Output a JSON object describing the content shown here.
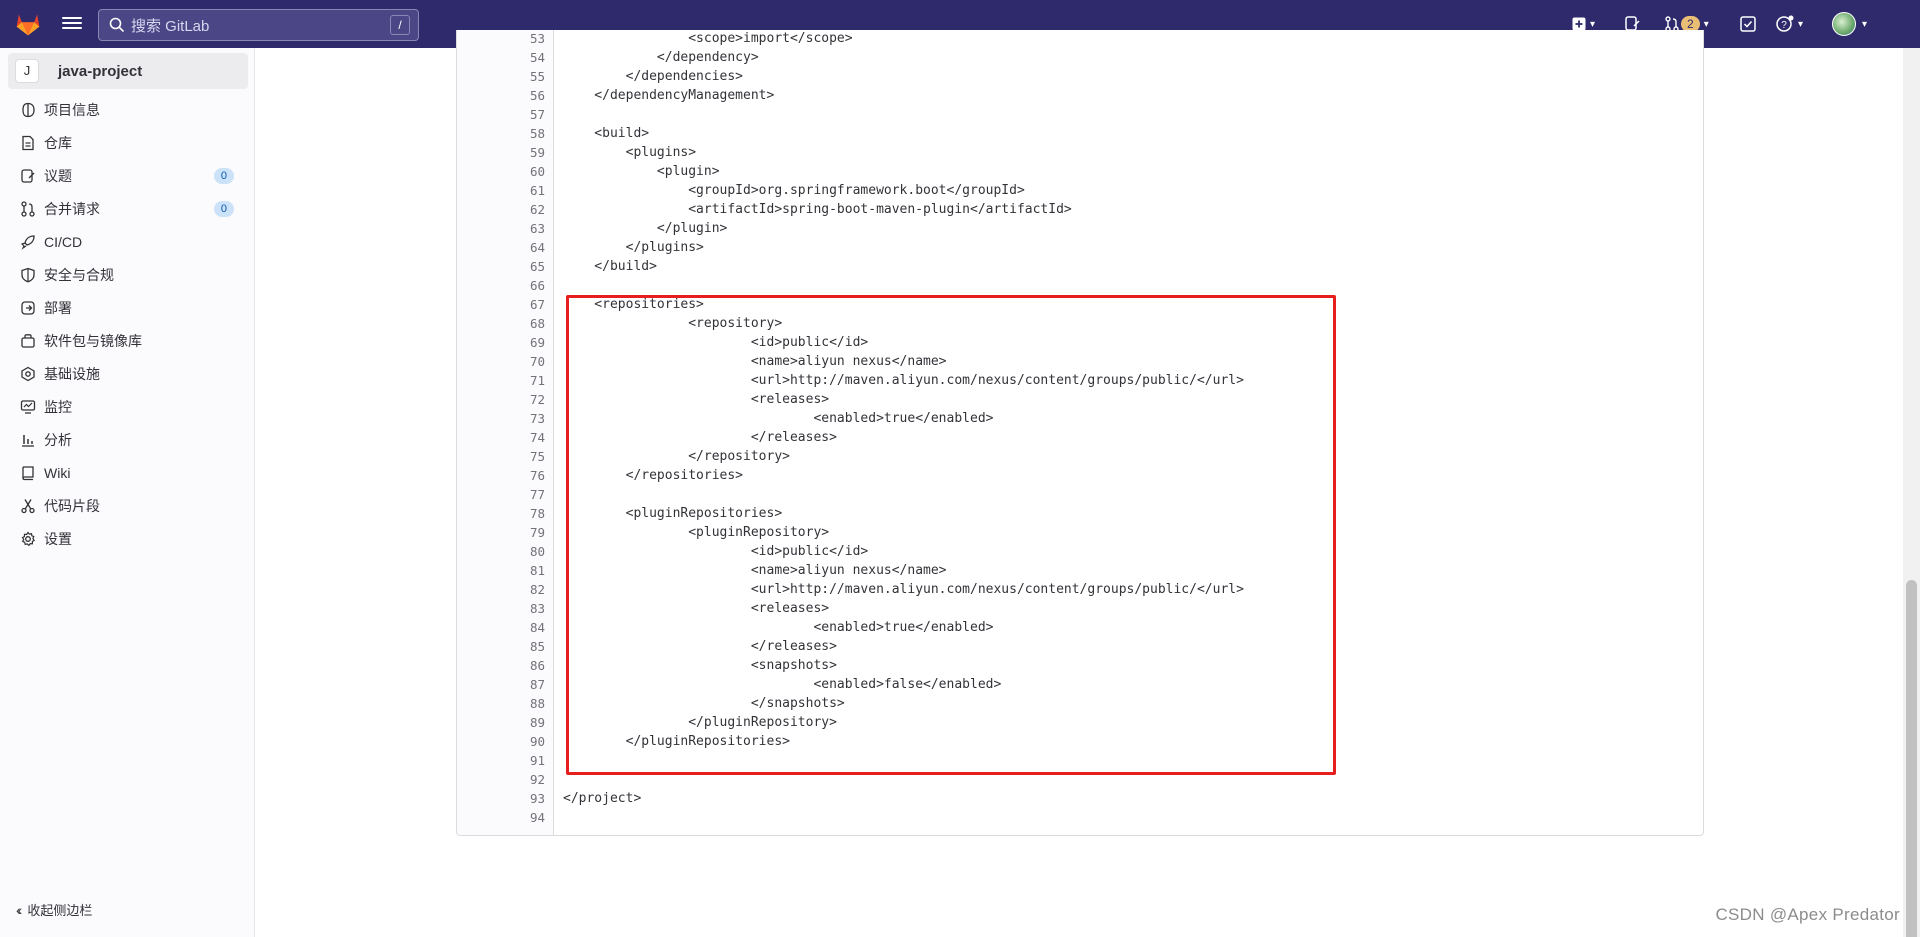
{
  "topbar": {
    "search_placeholder": "搜索 GitLab",
    "search_shortcut": "/",
    "merge_requests_count": "2"
  },
  "sidebar": {
    "project_avatar_letter": "J",
    "project_name": "java-project",
    "items": [
      {
        "label": "项目信息",
        "icon": "info-icon"
      },
      {
        "label": "仓库",
        "icon": "document-icon"
      },
      {
        "label": "议题",
        "icon": "issues-icon",
        "count": "0"
      },
      {
        "label": "合并请求",
        "icon": "merge-request-icon",
        "count": "0"
      },
      {
        "label": "CI/CD",
        "icon": "rocket-icon"
      },
      {
        "label": "安全与合规",
        "icon": "shield-icon"
      },
      {
        "label": "部署",
        "icon": "deployments-icon"
      },
      {
        "label": "软件包与镜像库",
        "icon": "package-icon"
      },
      {
        "label": "基础设施",
        "icon": "cloud-gear-icon"
      },
      {
        "label": "监控",
        "icon": "monitor-icon"
      },
      {
        "label": "分析",
        "icon": "chart-icon"
      },
      {
        "label": "Wiki",
        "icon": "book-icon"
      },
      {
        "label": "代码片段",
        "icon": "snippet-icon"
      },
      {
        "label": "设置",
        "icon": "settings-icon"
      }
    ],
    "collapse_label": "收起侧边栏"
  },
  "code": {
    "lines": [
      {
        "n": "53",
        "t": "                <scope>import</scope>"
      },
      {
        "n": "54",
        "t": "            </dependency>"
      },
      {
        "n": "55",
        "t": "        </dependencies>"
      },
      {
        "n": "56",
        "t": "    </dependencyManagement>"
      },
      {
        "n": "57",
        "t": ""
      },
      {
        "n": "58",
        "t": "    <build>"
      },
      {
        "n": "59",
        "t": "        <plugins>"
      },
      {
        "n": "60",
        "t": "            <plugin>"
      },
      {
        "n": "61",
        "t": "                <groupId>org.springframework.boot</groupId>"
      },
      {
        "n": "62",
        "t": "                <artifactId>spring-boot-maven-plugin</artifactId>"
      },
      {
        "n": "63",
        "t": "            </plugin>"
      },
      {
        "n": "64",
        "t": "        </plugins>"
      },
      {
        "n": "65",
        "t": "    </build>"
      },
      {
        "n": "66",
        "t": ""
      },
      {
        "n": "67",
        "t": "    <repositories>"
      },
      {
        "n": "68",
        "t": "                <repository>"
      },
      {
        "n": "69",
        "t": "                        <id>public</id>"
      },
      {
        "n": "70",
        "t": "                        <name>aliyun nexus</name>"
      },
      {
        "n": "71",
        "t": "                        <url>http://maven.aliyun.com/nexus/content/groups/public/</url>"
      },
      {
        "n": "72",
        "t": "                        <releases>"
      },
      {
        "n": "73",
        "t": "                                <enabled>true</enabled>"
      },
      {
        "n": "74",
        "t": "                        </releases>"
      },
      {
        "n": "75",
        "t": "                </repository>"
      },
      {
        "n": "76",
        "t": "        </repositories>"
      },
      {
        "n": "77",
        "t": ""
      },
      {
        "n": "78",
        "t": "        <pluginRepositories>"
      },
      {
        "n": "79",
        "t": "                <pluginRepository>"
      },
      {
        "n": "80",
        "t": "                        <id>public</id>"
      },
      {
        "n": "81",
        "t": "                        <name>aliyun nexus</name>"
      },
      {
        "n": "82",
        "t": "                        <url>http://maven.aliyun.com/nexus/content/groups/public/</url>"
      },
      {
        "n": "83",
        "t": "                        <releases>"
      },
      {
        "n": "84",
        "t": "                                <enabled>true</enabled>"
      },
      {
        "n": "85",
        "t": "                        </releases>"
      },
      {
        "n": "86",
        "t": "                        <snapshots>"
      },
      {
        "n": "87",
        "t": "                                <enabled>false</enabled>"
      },
      {
        "n": "88",
        "t": "                        </snapshots>"
      },
      {
        "n": "89",
        "t": "                </pluginRepository>"
      },
      {
        "n": "90",
        "t": "        </pluginRepositories>"
      },
      {
        "n": "91",
        "t": ""
      },
      {
        "n": "92",
        "t": ""
      },
      {
        "n": "93",
        "t": "</project>"
      },
      {
        "n": "94",
        "t": ""
      }
    ]
  },
  "watermark": "CSDN @Apex   Predator",
  "colors": {
    "navbar": "#2f2a6b",
    "highlight_border": "#e61e1e",
    "badge_blue": "#cbe2f9"
  }
}
